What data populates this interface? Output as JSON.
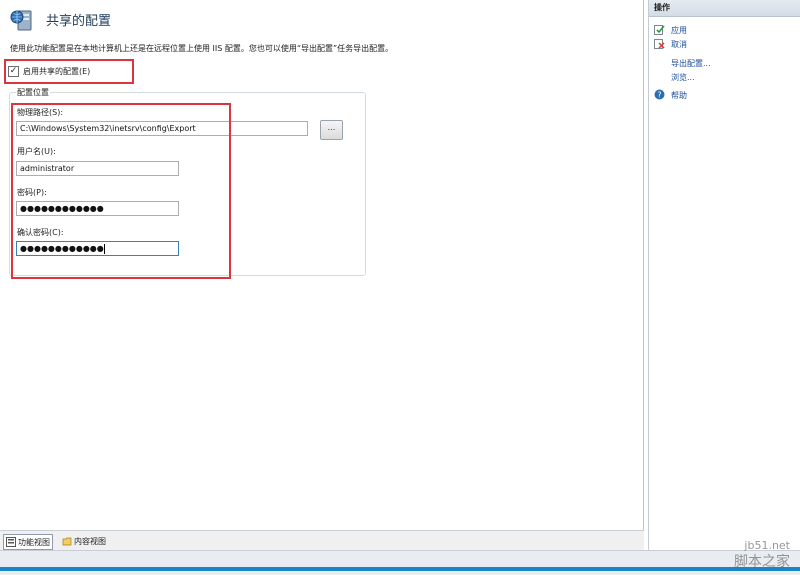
{
  "header": {
    "title": "共享的配置",
    "description": "使用此功能配置是在本地计算机上还是在远程位置上使用 IIS 配置。您也可以使用“导出配置”任务导出配置。"
  },
  "enable": {
    "label": "启用共享的配置(E)",
    "checked": true,
    "checkmark": "✓"
  },
  "config_location": {
    "group_title": "配置位置",
    "physical_path_label": "物理路径(S):",
    "physical_path_value": "C:\\Windows\\System32\\inetsrv\\config\\Export",
    "browse_label": "...",
    "username_label": "用户名(U):",
    "username_value": "administrator",
    "password_label": "密码(P):",
    "password_value": "●●●●●●●●●●●●",
    "confirm_label": "确认密码(C):",
    "confirm_value": "●●●●●●●●●●●●"
  },
  "tabs": {
    "features_view": "功能视图",
    "content_view": "内容视图"
  },
  "actions": {
    "header": "操作",
    "apply": "应用",
    "cancel": "取消",
    "export": "导出配置...",
    "browse": "浏览...",
    "help": "帮助"
  },
  "watermark": {
    "line1": "jb51.net",
    "line2": "脚本之家"
  },
  "colors": {
    "highlight": "#d9363e",
    "link": "#1c4e98"
  }
}
